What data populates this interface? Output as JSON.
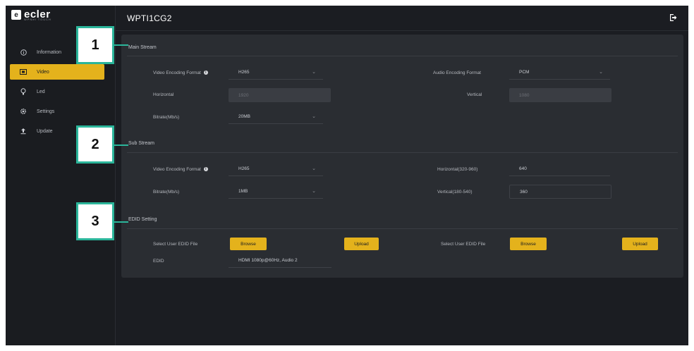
{
  "app": {
    "logo_text": "ecler",
    "logo_sub": "WPNet TOUCH",
    "device_title": "WPTI1CG2"
  },
  "sidebar": {
    "items": [
      {
        "label": "Information",
        "icon": "info-icon"
      },
      {
        "label": "Video",
        "icon": "video-icon"
      },
      {
        "label": "Led",
        "icon": "bulb-icon"
      },
      {
        "label": "Settings",
        "icon": "gear-icon"
      },
      {
        "label": "Update",
        "icon": "upload-icon"
      }
    ],
    "active_index": 1
  },
  "header": {
    "logout_icon": "logout-icon"
  },
  "main_stream": {
    "title": "Main Stream",
    "video_encoding_format_label": "Video Encoding Format",
    "video_encoding_format_value": "H265",
    "audio_encoding_format_label": "Audio Encoding Format",
    "audio_encoding_format_value": "PCM",
    "horizontal_label": "Horizontal",
    "horizontal_value": "1920",
    "vertical_label": "Vertical",
    "vertical_value": "1080",
    "bitrate_label": "Bitrate(Mb/s)",
    "bitrate_value": "20MB"
  },
  "sub_stream": {
    "title": "Sub Stream",
    "video_encoding_format_label": "Video Encoding Format",
    "video_encoding_format_value": "H265",
    "bitrate_label": "Bitrate(Mb/s)",
    "bitrate_value": "1MB",
    "horizontal_label": "Horizontal(320-960)",
    "horizontal_value": "640",
    "vertical_label": "Vertical(180-540)",
    "vertical_value": "360"
  },
  "edid_setting": {
    "title": "EDID Setting",
    "select_edid_label_1": "Select User EDID File",
    "browse_label_1": "Browse",
    "upload_label_1": "Upload",
    "select_edid_label_2": "Select User EDID File",
    "browse_label_2": "Browse",
    "upload_label_2": "Upload",
    "edid_label": "EDID",
    "edid_value": "HDMI 1080p@60Hz, Audio 2"
  },
  "callouts": [
    "1",
    "2",
    "3"
  ],
  "colors": {
    "accent": "#e4b21c",
    "callout": "#2bb59a",
    "background": "#1b1d22",
    "panel": "#2a2d32"
  }
}
